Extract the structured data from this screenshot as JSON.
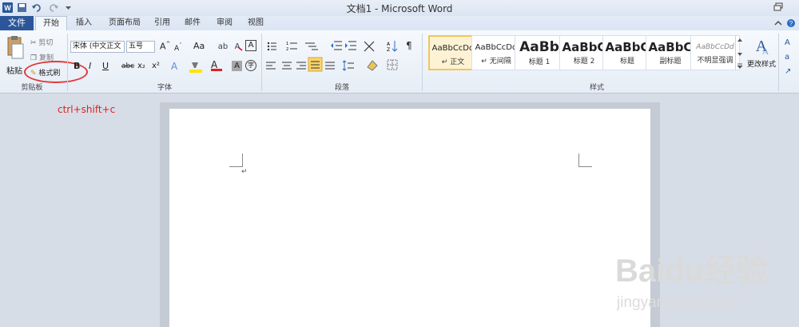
{
  "window": {
    "title": "文档1 - Microsoft Word"
  },
  "quick_access": {
    "icons": [
      "word-logo-icon",
      "save-icon",
      "undo-icon",
      "redo-icon",
      "customize-icon"
    ]
  },
  "tabs": [
    "文件",
    "开始",
    "插入",
    "页面布局",
    "引用",
    "邮件",
    "审阅",
    "视图"
  ],
  "clipboard": {
    "paste_label": "粘贴",
    "cut_label": "剪切",
    "copy_label": "复制",
    "format_painter_label": "格式刷",
    "group_label": "剪贴板"
  },
  "font": {
    "font_name": "宋体 (中文正文",
    "font_size": "五号",
    "group_label": "字体",
    "bold": "B",
    "italic": "I",
    "underline": "U",
    "strike": "abc",
    "subscript": "x₂",
    "superscript": "x²",
    "grow": "A",
    "shrink": "A",
    "change_case": "Aa",
    "font_color": "A",
    "char_shade": "A",
    "char_border": "A",
    "enclose": "字"
  },
  "paragraph": {
    "group_label": "段落"
  },
  "styles": {
    "group_label": "样式",
    "items": [
      {
        "sample": "AaBbCcDd",
        "name": "↵ 正文"
      },
      {
        "sample": "AaBbCcDd",
        "name": "↵ 无间隔"
      },
      {
        "sample": "AaBb",
        "name": "标题 1"
      },
      {
        "sample": "AaBbC",
        "name": "标题 2"
      },
      {
        "sample": "AaBbC",
        "name": "标题"
      },
      {
        "sample": "AaBbC",
        "name": "副标题"
      },
      {
        "sample": "AaBbCcDd",
        "name": "不明显强调"
      }
    ],
    "change_styles_label": "更改样式"
  },
  "annotation": {
    "text": "ctrl+shift+c",
    "color": "#e02020"
  },
  "document": {
    "paragraph_mark": "↵"
  },
  "watermark": {
    "brand": "Baidu经验",
    "url": "jingyan.baidu.com"
  },
  "colors": {
    "file_tab": "#2b579a",
    "ribbon_border": "#b7c5d9",
    "oval": "#e03a3a"
  }
}
